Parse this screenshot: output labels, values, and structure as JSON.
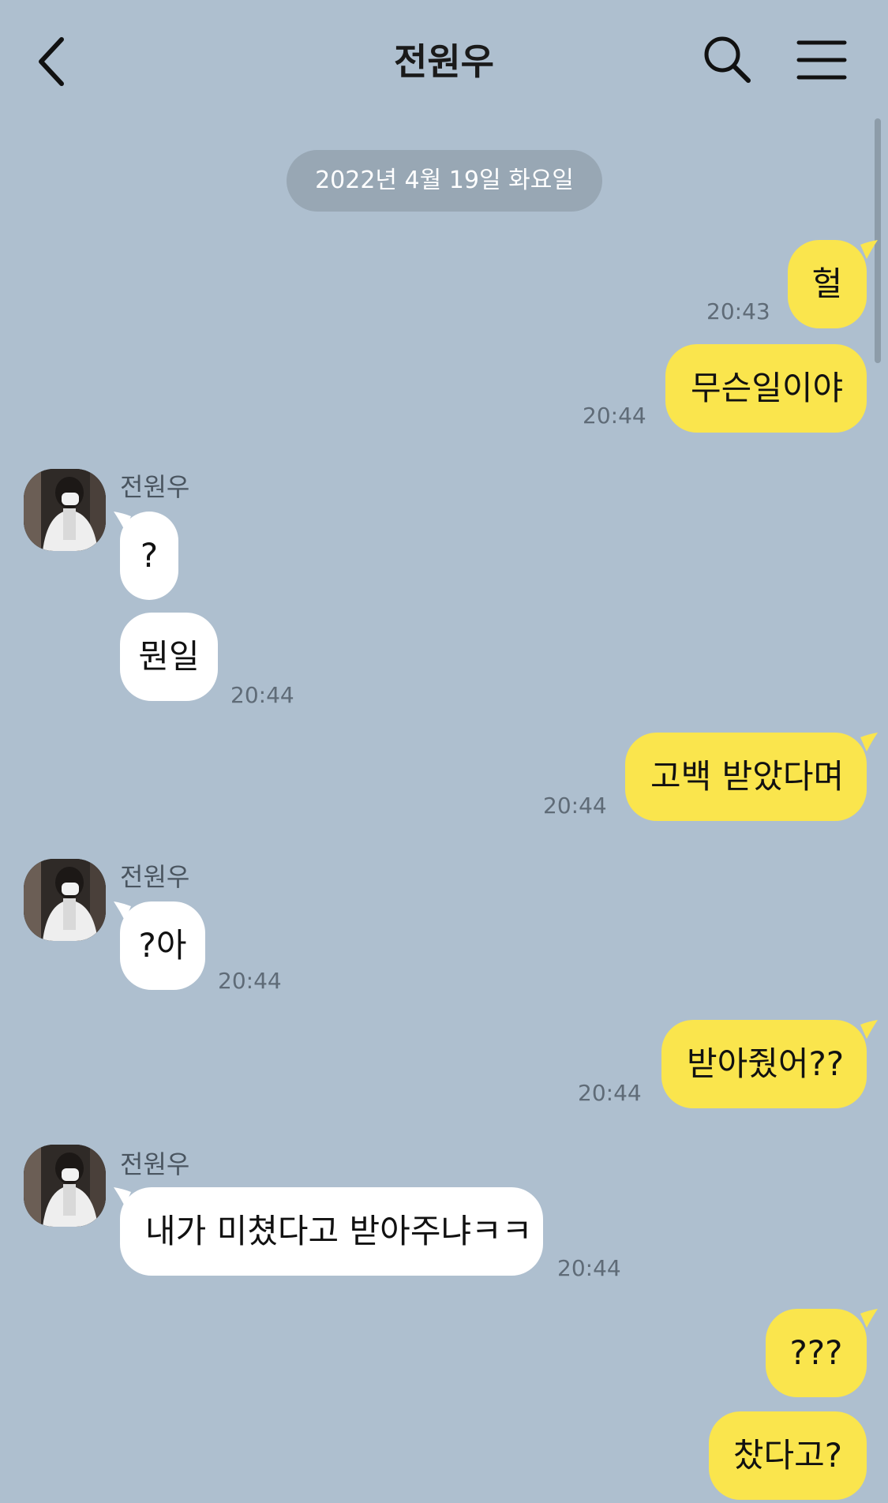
{
  "header": {
    "title": "전원우"
  },
  "date_divider": "2022년 4월 19일 화요일",
  "messages": {
    "m1": {
      "text": "헐",
      "time": "20:43"
    },
    "m2": {
      "text": "무슨일이야",
      "time": "20:44"
    },
    "t1": {
      "sender": "전원우",
      "text": "?"
    },
    "t2": {
      "text": "뭔일",
      "time": "20:44"
    },
    "m3": {
      "text": "고백 받았다며",
      "time": "20:44"
    },
    "t3": {
      "sender": "전원우",
      "text": "?아",
      "time": "20:44"
    },
    "m4": {
      "text": "받아줬어??",
      "time": "20:44"
    },
    "t4": {
      "sender": "전원우",
      "text": "내가 미쳤다고 받아주냐ㅋㅋ",
      "time": "20:44"
    },
    "m5": {
      "text": "???"
    },
    "m6": {
      "text": "찼다고?"
    }
  },
  "colors": {
    "background": "#aebfcf",
    "my_bubble": "#fae54d",
    "their_bubble": "#ffffff",
    "date_pill": "#98a7b4"
  },
  "icons": [
    "back-arrow-icon",
    "search-icon",
    "menu-icon"
  ]
}
